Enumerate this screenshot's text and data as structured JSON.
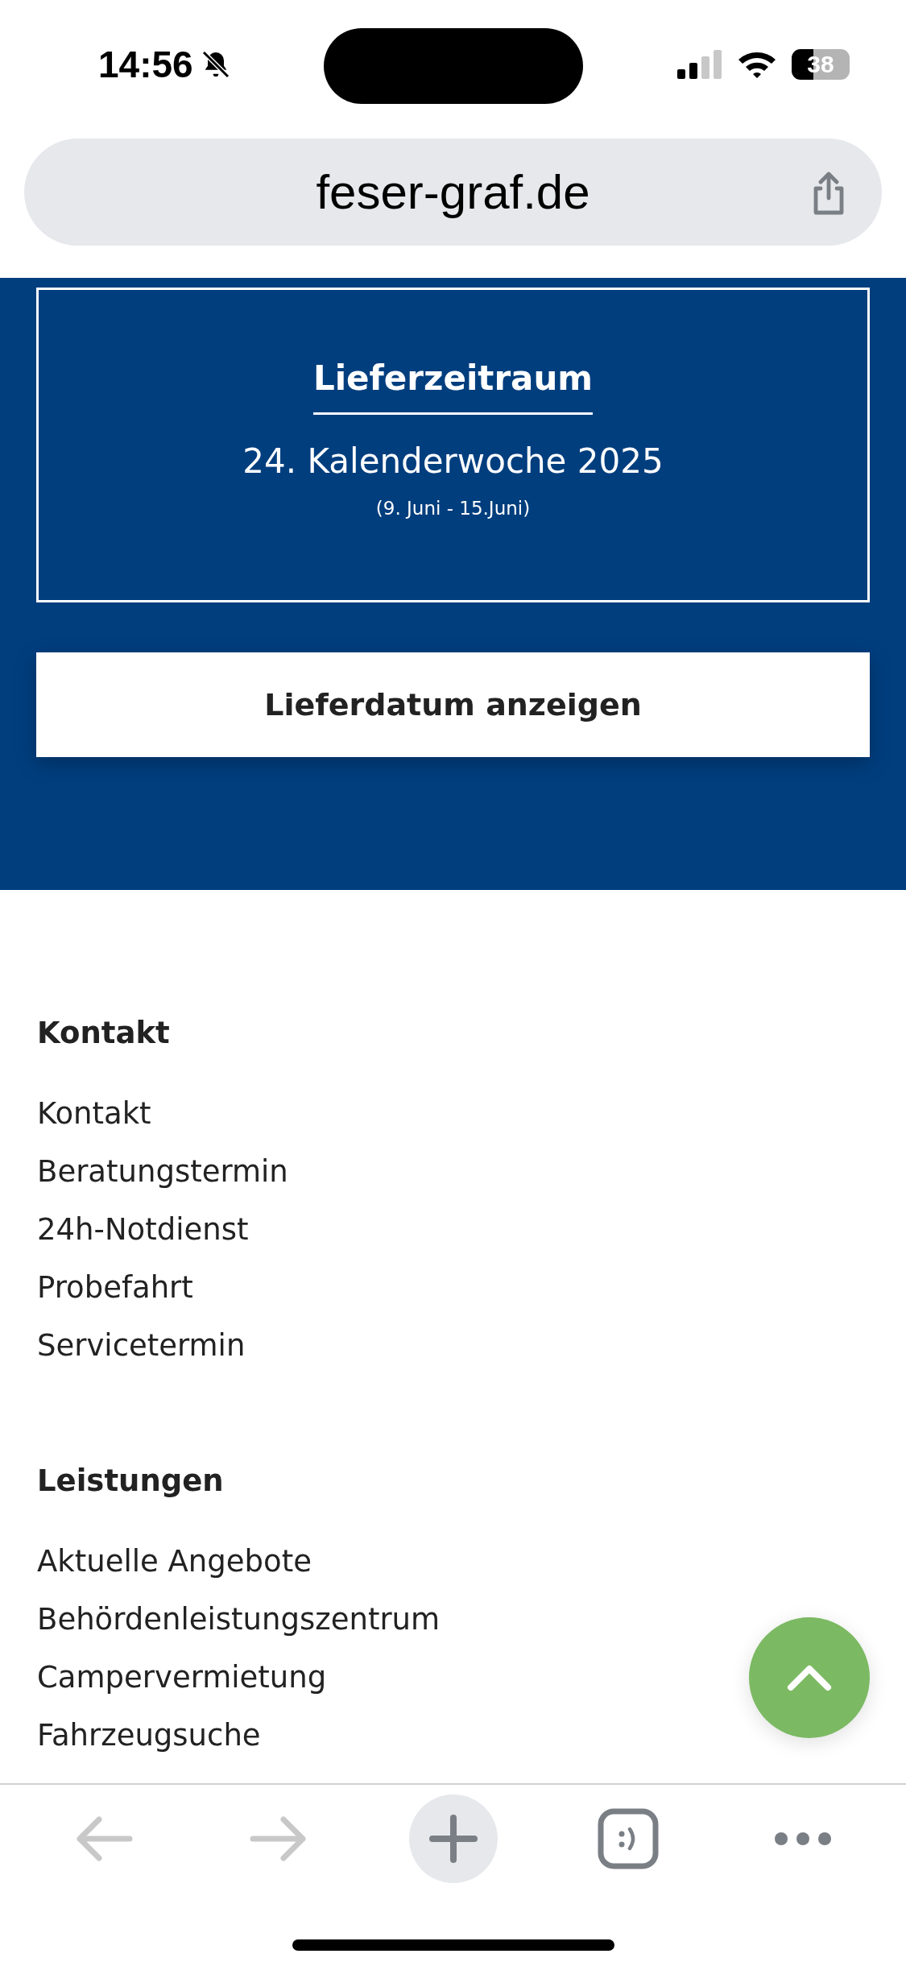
{
  "status_bar": {
    "time": "14:56",
    "battery": "38"
  },
  "address_bar": {
    "url": "feser-graf.de"
  },
  "delivery": {
    "title": "Lieferzeitraum",
    "week": "24. Kalenderwoche 2025",
    "range": "(9. Juni - 15.Juni)",
    "button": "Lieferdatum anzeigen"
  },
  "footer_sections": [
    {
      "heading": "Kontakt",
      "links": [
        "Kontakt",
        "Beratungstermin",
        "24h-Notdienst",
        "Probefahrt",
        "Servicetermin"
      ]
    },
    {
      "heading": "Leistungen",
      "links": [
        "Aktuelle Angebote",
        "Behördenleistungszentrum",
        "Campervermietung",
        "Fahrzeugsuche"
      ]
    }
  ],
  "navigation": {
    "back_disabled": true,
    "forward_disabled": true
  }
}
